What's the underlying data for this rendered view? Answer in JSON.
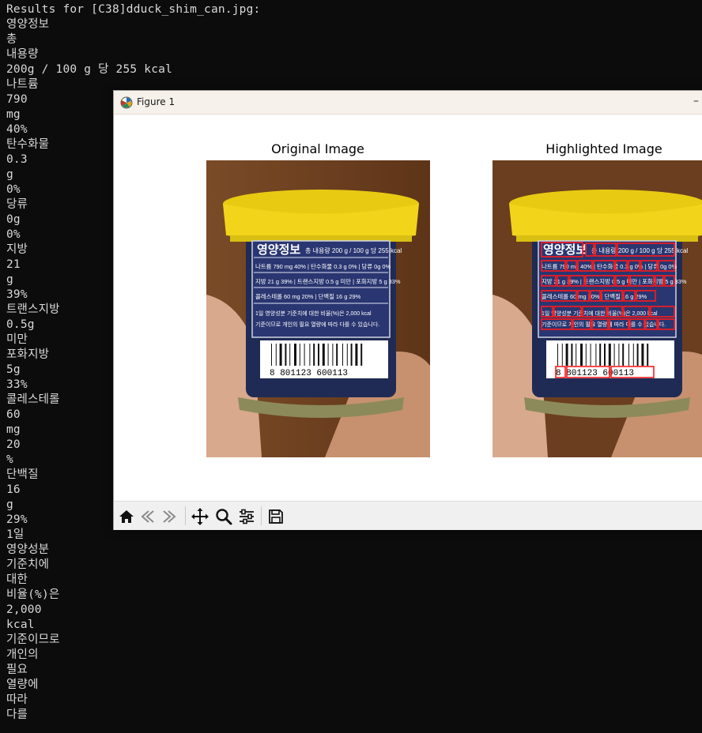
{
  "terminal": {
    "header": "Results for [C38]dduck_shim_can.jpg:",
    "lines": [
      "영양정보",
      "총",
      "내용량",
      "200g / 100 g 당 255 kcal",
      "나트륨",
      "790",
      "mg",
      "40%",
      "탄수화물",
      "0.3",
      "g",
      "0%",
      "당류",
      "0g",
      "0%",
      "지방",
      "21",
      "g",
      "39%",
      "트랜스지방",
      "0.5g",
      "미만",
      "포화지방",
      "5g",
      "33%",
      "콜레스테롤",
      "60",
      "mg",
      "20",
      "%",
      "단백질",
      "16",
      "g",
      "29%",
      "1일",
      "영양성분",
      "기준치에",
      "대한",
      "비율(%)은",
      "2,000",
      "kcal",
      "기준이므로",
      "개인의",
      "필요",
      "열량에",
      "따라",
      "다를"
    ]
  },
  "window": {
    "title": "Figure 1",
    "minimize_glyph": "–",
    "original_title": "Original Image",
    "highlighted_title": "Highlighted Image"
  },
  "label": {
    "title": "영양정보",
    "content": "총 내용량 200 g / 100 g 당 255 kcal",
    "row1": "나트륨 790 mg 40% | 탄수화물 0.3 g 0% | 당류 0g 0%",
    "row2": "지방 21 g 39% | 트랜스지방 0.5 g 미만 | 포화지방 5 g 33%",
    "row3": "콜레스테롤 60 mg 20% | 단백질 16 g 29%",
    "note1": "1일 영양성분 기준치에 대한 비율(%)은 2,000 kcal",
    "note2": "기준이므로 개인의 필요 열량에 따라 다를 수 있습니다.",
    "barcode": "8 801123 600113"
  },
  "toolbar": {
    "icons": [
      "home-icon",
      "back-arrow-icon",
      "forward-arrow-icon",
      "pan-move-icon",
      "zoom-magnifier-icon",
      "configure-subplots-icon",
      "save-floppy-icon"
    ]
  },
  "colors": {
    "terminal_bg": "#0c0c0c",
    "terminal_text": "#d9d9d9",
    "can_yellow": "#f2d51a",
    "label_navy": "#2a3671",
    "highlight_red": "#ff1a1a"
  }
}
